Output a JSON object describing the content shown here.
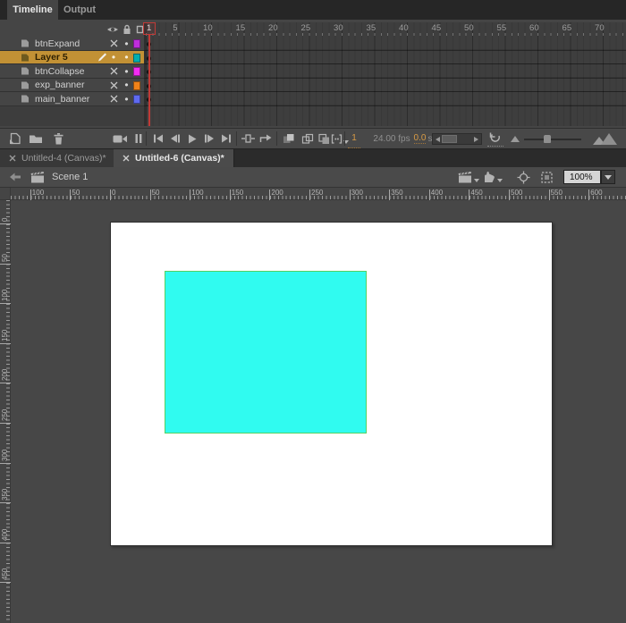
{
  "panel_tabs": [
    {
      "label": "Timeline",
      "active": true
    },
    {
      "label": "Output",
      "active": false
    }
  ],
  "timeline": {
    "header_icons": [
      "eye-icon",
      "lock-icon",
      "outline-square-icon"
    ],
    "frame_numbers": [
      "1",
      "5",
      "10",
      "15",
      "20",
      "25",
      "30",
      "35",
      "40",
      "45",
      "50",
      "55",
      "60",
      "65",
      "70"
    ],
    "layers": [
      {
        "name": "btnExpand",
        "visible": false,
        "locked": false,
        "outline_color": "#be2edd",
        "selected": false
      },
      {
        "name": "Layer 5",
        "visible": true,
        "locked": false,
        "outline_color": "#00aeae",
        "selected": true
      },
      {
        "name": "btnCollapse",
        "visible": false,
        "locked": false,
        "outline_color": "#f32cf3",
        "selected": false
      },
      {
        "name": "exp_banner",
        "visible": false,
        "locked": false,
        "outline_color": "#f08219",
        "selected": false
      },
      {
        "name": "main_banner",
        "visible": false,
        "locked": false,
        "outline_color": "#5f6aef",
        "selected": false
      }
    ],
    "selected_row_color": "#c29135",
    "playhead_color": "#c03a37",
    "keyframe_at": "1",
    "controls": {
      "current_frame": "1",
      "frame_rate": "24.00 fps",
      "elapsed_time": "0.0",
      "time_unit": "s"
    }
  },
  "document_tabs": [
    {
      "label": "Untitled-4 (Canvas)*",
      "active": false
    },
    {
      "label": "Untitled-6 (Canvas)*",
      "active": true
    }
  ],
  "edit_bar": {
    "scene_label": "Scene 1",
    "zoom_value": "100%"
  },
  "rulers": {
    "horizontal_labels": [
      "100",
      "50",
      "0",
      "50",
      "100",
      "150",
      "200",
      "250",
      "300",
      "350",
      "400",
      "450",
      "500",
      "550",
      "600"
    ],
    "vertical_labels": [
      "0",
      "50",
      "100",
      "150",
      "200",
      "250",
      "300",
      "350",
      "400",
      "450"
    ]
  },
  "stage": {
    "background": "#ffffff",
    "rect_fill": "#30fbf0",
    "rect_stroke": "#54d162"
  },
  "glyphs": {
    "dot": "•"
  }
}
